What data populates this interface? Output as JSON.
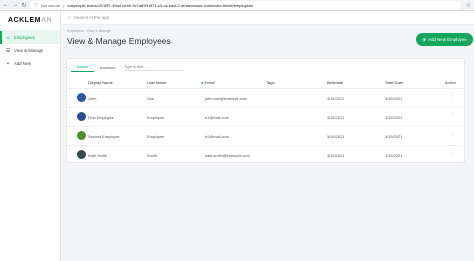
{
  "browser": {
    "secure_label": "Not secure",
    "url": "cdspeople.bsd/a/c5/1f97-45a4-bc4b-9c7a89f16f71.s3-us-east-2.amazonaws.com/index.html#/employees"
  },
  "app": {
    "logo_main": "ACKLEM",
    "logo_faded": "AN"
  },
  "sidebar": {
    "items": [
      {
        "label": "Employees",
        "icon": "users-icon",
        "active": true
      },
      {
        "label": "View & Manage",
        "icon": "list-icon",
        "active": false
      },
      {
        "label": "Add New",
        "icon": "person-add-icon",
        "active": false
      }
    ]
  },
  "search": {
    "placeholder": "Search in the app"
  },
  "header": {
    "breadcrumb": "Employees  ›  View & Manage",
    "title": "View & Manage Employees",
    "add_button": "Add New Employee"
  },
  "tabs": [
    {
      "label": "Active",
      "active": true
    },
    {
      "label": "Archived",
      "active": false
    }
  ],
  "filter": {
    "placeholder": "Type to filter..."
  },
  "table": {
    "columns": [
      "Display Name",
      "Last Name",
      "Email",
      "Tags",
      "Birthdate",
      "Start Date",
      "Action"
    ],
    "rows": [
      {
        "display": "John",
        "last": "Doe",
        "email": "john.doe@example.com",
        "tags": "",
        "birthdate": "3/15/2021",
        "start": "3/15/2021",
        "avatar_color": "#2f55a4",
        "action": "⋮"
      },
      {
        "display": "First Employee",
        "last": "Employee",
        "email": "e1@mail.com",
        "tags": "",
        "birthdate": "3/15/2021",
        "start": "3/15/2021",
        "avatar_color": "#2a4d8f",
        "action": "⋮"
      },
      {
        "display": "Second Employee",
        "last": "Employee",
        "email": "e2@mail.com",
        "tags": "",
        "birthdate": "3/15/2021",
        "start": "3/15/2021",
        "avatar_color": "#4c8f2d",
        "action": "⋮"
      },
      {
        "display": "Kate Smith",
        "last": "Smith",
        "email": "kate.smith@example.com",
        "tags": "",
        "birthdate": "3/15/2021",
        "start": "3/15/2021",
        "avatar_color": "#37474f",
        "action": "⋮"
      }
    ]
  },
  "colors": {
    "accent": "#13a75d"
  }
}
